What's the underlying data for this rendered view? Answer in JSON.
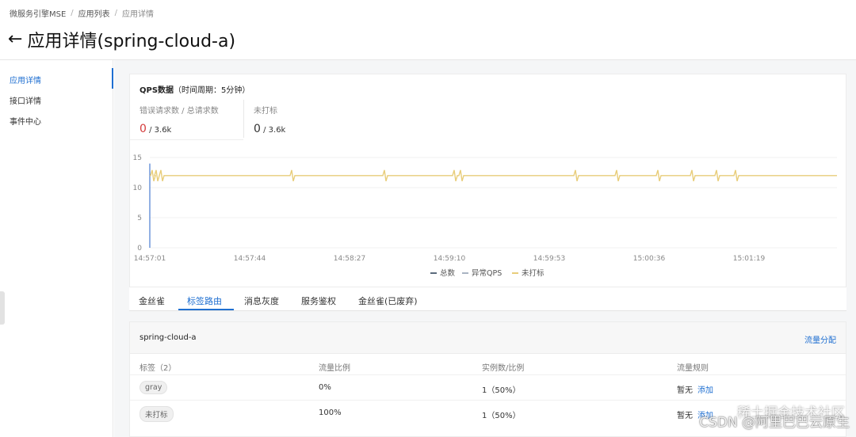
{
  "breadcrumb": {
    "items": [
      "微服务引擎MSE",
      "应用列表",
      "应用详情"
    ],
    "sep": "/"
  },
  "header": {
    "back_icon": "arrow-left-icon",
    "back_glyph": "←",
    "title": "应用详情(spring-cloud-a)"
  },
  "sidebar": {
    "items": [
      {
        "label": "应用详情",
        "active": true
      },
      {
        "label": "接口详情",
        "active": false
      },
      {
        "label": "事件中心",
        "active": false
      }
    ]
  },
  "qps": {
    "title": "QPS数据",
    "period": "（时间周期：5分钟）",
    "stats": [
      {
        "label": "错误请求数 / 总请求数",
        "value": "0",
        "total": "/ 3.6k",
        "value_color": "#d43b3b"
      },
      {
        "label": "未打标",
        "value": "0",
        "total": "/ 3.6k",
        "value_color": "#333333"
      }
    ]
  },
  "chart_data": {
    "type": "line",
    "x": [
      "14:57:01",
      "14:57:44",
      "14:58:27",
      "14:59:10",
      "14:59:53",
      "15:00:36",
      "15:01:19"
    ],
    "ylim": [
      0,
      15
    ],
    "yticks": [
      0,
      5,
      10,
      15
    ],
    "series": [
      {
        "name": "总数",
        "color": "#5b6b7c",
        "values": []
      },
      {
        "name": "异常QPS",
        "color": "#a9b4c2",
        "values": []
      },
      {
        "name": "未打标",
        "color": "#e8cd7a",
        "values": [
          12,
          12,
          12,
          12,
          12,
          12,
          12
        ]
      }
    ],
    "legend_position": "bottom-center",
    "grid": true
  },
  "tabs": {
    "items": [
      "金丝雀",
      "标签路由",
      "消息灰度",
      "服务鉴权",
      "金丝雀(已废弃)"
    ],
    "active_index": 1
  },
  "route": {
    "name": "spring-cloud-a",
    "action": "流量分配",
    "columns": [
      "标签（2）",
      "流量比例",
      "实例数/比例",
      "流量规则"
    ],
    "rows": [
      {
        "tag": "gray",
        "ratio": "0%",
        "instances": "1（50%）",
        "rule": "暂无",
        "rule_action": "添加"
      },
      {
        "tag": "未打标",
        "ratio": "100%",
        "instances": "1（50%）",
        "rule": "暂无",
        "rule_action": "添加"
      }
    ]
  },
  "watermark": {
    "line1": "稀土掘金技术社区",
    "line2": "CSDN @阿里巴巴云原生"
  },
  "colors": {
    "accent": "#1f6fd1",
    "error": "#d43b3b",
    "line_untagged": "#e8cd7a"
  }
}
